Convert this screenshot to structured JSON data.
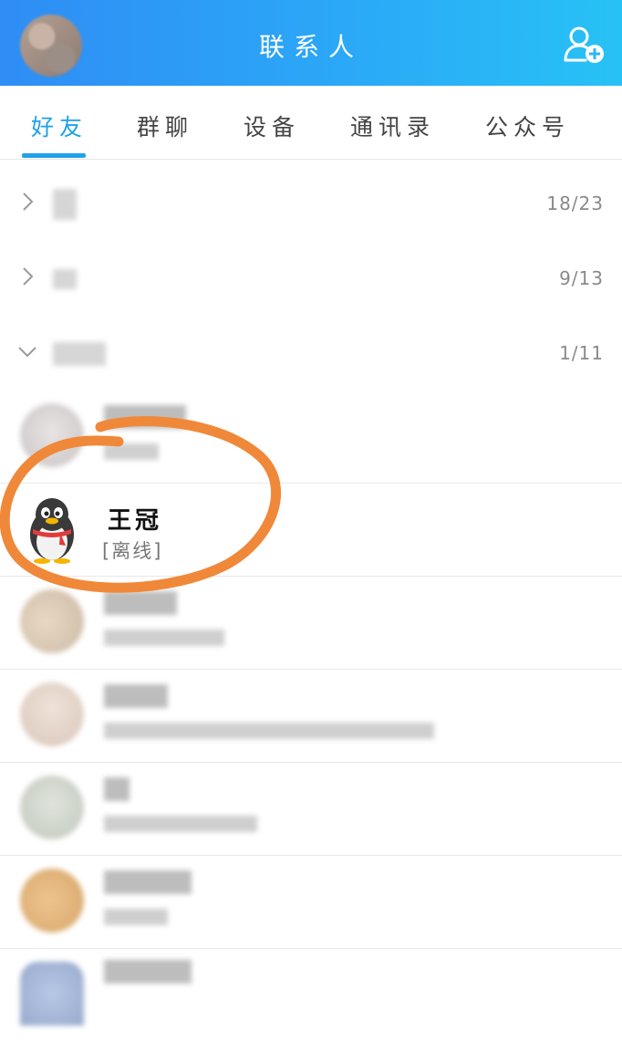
{
  "header": {
    "title": "联系人",
    "avatar_icon": "blurred-avatar",
    "add_icon": "add-friend-icon",
    "colors": {
      "start": "#2f8df5",
      "end": "#27c2f5"
    }
  },
  "tabs": [
    {
      "label": "好友",
      "active": true
    },
    {
      "label": "群聊",
      "active": false
    },
    {
      "label": "设备",
      "active": false
    },
    {
      "label": "通讯录",
      "active": false
    },
    {
      "label": "公众号",
      "active": false
    }
  ],
  "accent": "#1fa2e8",
  "groups": [
    {
      "count": "18/23",
      "expanded": false
    },
    {
      "count": "9/13",
      "expanded": false
    },
    {
      "count": "1/11",
      "expanded": true
    }
  ],
  "contacts": [
    {
      "name": "王冠",
      "status": "[离线]",
      "avatar_icon": "qq-penguin-icon"
    }
  ],
  "annotation_color": "#f0883a"
}
